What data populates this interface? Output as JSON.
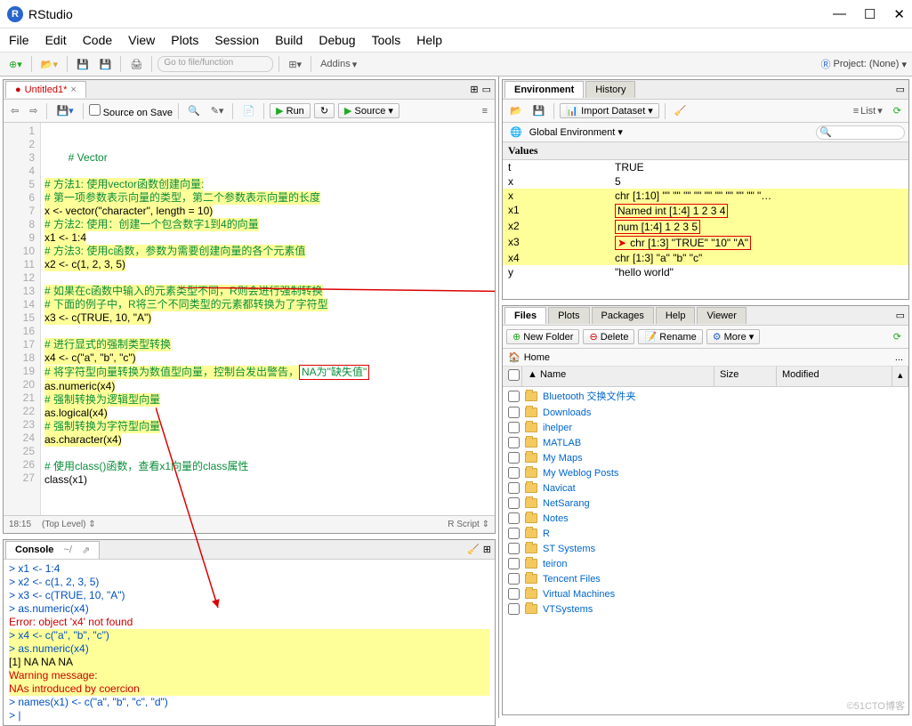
{
  "window": {
    "title": "RStudio"
  },
  "menu": [
    "File",
    "Edit",
    "Code",
    "View",
    "Plots",
    "Session",
    "Build",
    "Debug",
    "Tools",
    "Help"
  ],
  "toolbar": {
    "goto_placeholder": "Go to file/function",
    "addins": "Addins",
    "project": "Project: (None)"
  },
  "source": {
    "tab": "Untitled1*",
    "save_on_source": "Source on Save",
    "run": "Run",
    "source_btn": "Source",
    "cursor": "18:15",
    "scope": "(Top Level)",
    "lang": "R Script",
    "lines": [
      {
        "n": 1,
        "raw": "# Vector",
        "cls": "cm"
      },
      {
        "n": 2,
        "raw": ""
      },
      {
        "n": 3,
        "raw": "# 方法1: 使用vector函数创建向量:",
        "cls": "cm hl"
      },
      {
        "n": 4,
        "raw": "# 第一项参数表示向量的类型，第二个参数表示向量的长度",
        "cls": "cm hl"
      },
      {
        "n": 5,
        "raw": "x <- vector(\"character\", length = 10)",
        "cls": "hl"
      },
      {
        "n": 6,
        "raw": "# 方法2: 使用：创建一个包含数字1到4的向量",
        "cls": "cm hl"
      },
      {
        "n": 7,
        "raw": "x1 <- 1:4",
        "cls": "hl"
      },
      {
        "n": 8,
        "raw": "# 方法3: 使用c函数，参数为需要创建向量的各个元素值",
        "cls": "cm hl"
      },
      {
        "n": 9,
        "raw": "x2 <- c(1, 2, 3, 5)",
        "cls": "hl"
      },
      {
        "n": 10,
        "raw": ""
      },
      {
        "n": 11,
        "raw": "# 如果在c函数中输入的元素类型不同，R则会进行强制转换",
        "cls": "cm hl"
      },
      {
        "n": 12,
        "raw": "# 下面的例子中，R将三个不同类型的元素都转换为了字符型",
        "cls": "cm hl"
      },
      {
        "n": 13,
        "raw": "x3 <- c(TRUE, 10, \"A\")",
        "cls": "hl"
      },
      {
        "n": 14,
        "raw": ""
      },
      {
        "n": 15,
        "raw": "# 进行显式的强制类型转换",
        "cls": "cm hl"
      },
      {
        "n": 16,
        "raw": "x4 <- c(\"a\", \"b\", \"c\")",
        "cls": "hl"
      },
      {
        "n": 17,
        "raw": "# 将字符型向量转换为数值型向量，控制台发出警告，",
        "cls": "cm hl",
        "box": "NA为\"缺失值\""
      },
      {
        "n": 18,
        "raw": "as.numeric(x4)",
        "cls": "hl"
      },
      {
        "n": 19,
        "raw": "# 强制转换为逻辑型向量",
        "cls": "cm hl"
      },
      {
        "n": 20,
        "raw": "as.logical(x4)",
        "cls": "hl"
      },
      {
        "n": 21,
        "raw": "# 强制转换为字符型向量",
        "cls": "cm hl"
      },
      {
        "n": 22,
        "raw": "as.character(x4)",
        "cls": "hl"
      },
      {
        "n": 23,
        "raw": ""
      },
      {
        "n": 24,
        "raw": "# 使用class()函数，查看x1向量的class属性",
        "cls": "cm"
      },
      {
        "n": 25,
        "raw": "class(x1)",
        "cls": ""
      },
      {
        "n": 26,
        "raw": ""
      },
      {
        "n": 27,
        "raw": ""
      }
    ]
  },
  "console": {
    "title": "Console",
    "path": "~/",
    "lines": [
      {
        "t": "> x1 <- 1:4",
        "c": "p"
      },
      {
        "t": "> x2 <- c(1, 2, 3, 5)",
        "c": "p"
      },
      {
        "t": "> x3 <- c(TRUE, 10, \"A\")",
        "c": "p"
      },
      {
        "t": "> as.numeric(x4)",
        "c": "p"
      },
      {
        "t": "Error: object 'x4' not found",
        "c": "err"
      },
      {
        "t": "> x4 <- c(\"a\", \"b\", \"c\")",
        "c": "p hlc"
      },
      {
        "t": "> as.numeric(x4)",
        "c": "p hlc"
      },
      {
        "t": "[1] NA NA NA",
        "c": "out hlc"
      },
      {
        "t": "Warning message:",
        "c": "err hlc"
      },
      {
        "t": "NAs introduced by coercion",
        "c": "err hlc"
      },
      {
        "t": "> names(x1) <- c(\"a\", \"b\", \"c\", \"d\")",
        "c": "p"
      },
      {
        "t": "> |",
        "c": "p"
      }
    ]
  },
  "env": {
    "tabs": [
      "Environment",
      "History"
    ],
    "import": "Import Dataset",
    "list": "List",
    "scope": "Global Environment",
    "section": "Values",
    "rows": [
      {
        "k": "t",
        "v": "TRUE"
      },
      {
        "k": "x",
        "v": "5"
      },
      {
        "k": "x",
        "v": "chr [1:10] \"\" \"\" \"\" \"\" \"\" \"\" \"\" \"\" \"\" \"…",
        "yl": true
      },
      {
        "k": "x1",
        "v": "Named int [1:4] 1 2 3 4",
        "yl": true,
        "box": true
      },
      {
        "k": "x2",
        "v": "num [1:4] 1 2 3 5",
        "yl": true,
        "box": true
      },
      {
        "k": "x3",
        "v": "chr [1:3] \"TRUE\" \"10\" \"A\"",
        "yl": true,
        "box": true,
        "arrow": true
      },
      {
        "k": "x4",
        "v": "chr [1:3] \"a\" \"b\" \"c\"",
        "yl": true
      },
      {
        "k": "y",
        "v": "\"hello world\""
      }
    ]
  },
  "files": {
    "tabs": [
      "Files",
      "Plots",
      "Packages",
      "Help",
      "Viewer"
    ],
    "new_folder": "New Folder",
    "delete": "Delete",
    "rename": "Rename",
    "more": "More",
    "home": "Home",
    "cols": [
      "",
      "▲ Name",
      "Size",
      "Modified"
    ],
    "items": [
      "Bluetooth 交换文件夹",
      "Downloads",
      "ihelper",
      "MATLAB",
      "My Maps",
      "My Weblog Posts",
      "Navicat",
      "NetSarang",
      "Notes",
      "R",
      "ST Systems",
      "teiron",
      "Tencent Files",
      "Virtual Machines",
      "VTSystems"
    ]
  },
  "watermark": "©51CTO博客"
}
